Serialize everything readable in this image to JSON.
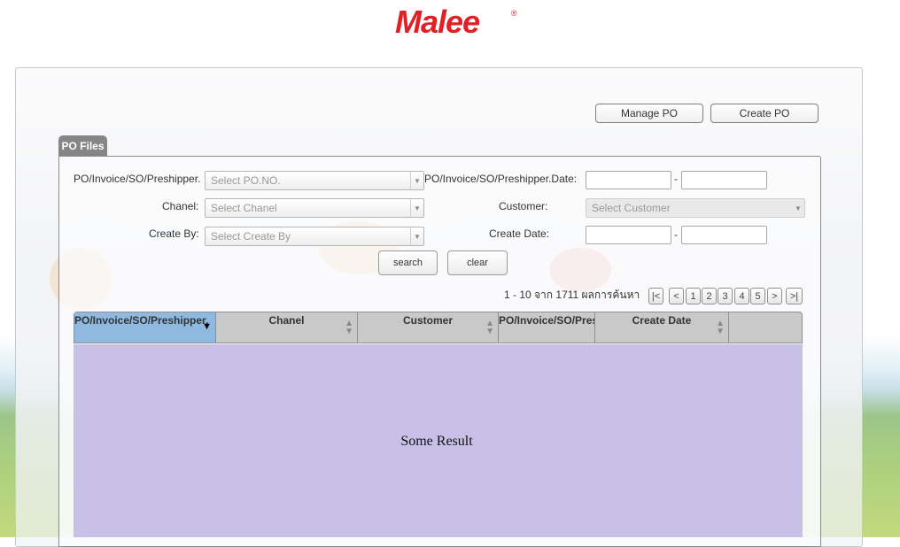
{
  "brand": {
    "logo_text": "Malee",
    "registered": "®",
    "color": "#e31e24"
  },
  "actions": {
    "manage_po": "Manage PO",
    "create_po": "Create PO"
  },
  "tab": {
    "label": "PO Files"
  },
  "form": {
    "po_label": "PO/Invoice/SO/Preshipper.",
    "po_placeholder": "Select PO.NO.",
    "po_date_label": "PO/Invoice/SO/Preshipper.Date:",
    "chanel_label": "Chanel:",
    "chanel_placeholder": "Select Chanel",
    "customer_label": "Customer:",
    "customer_placeholder": "Select Customer",
    "create_by_label": "Create By:",
    "create_by_placeholder": "Select Create By",
    "create_date_label": "Create Date:",
    "dash": "-",
    "search_label": "search",
    "clear_label": "clear"
  },
  "pager": {
    "summary": "1 - 10 จาก 1711 ผลการค้นหา",
    "first": "|<",
    "prev": "<",
    "pages": [
      "1",
      "2",
      "3",
      "4",
      "5"
    ],
    "next": ">",
    "last": ">|"
  },
  "grid": {
    "columns": [
      "PO/Invoice/SO/Preshipper.",
      "Chanel",
      "Customer",
      "PO/Invoice/SO/Preshipper.Date",
      "Create Date",
      ""
    ],
    "sort_active_column": 0,
    "result_text": "Some Result"
  },
  "colors": {
    "header_active": "#8fb9df",
    "header": "#c9c9c9",
    "result_bg": "#c8c0e6",
    "tab_bg": "#868686"
  }
}
